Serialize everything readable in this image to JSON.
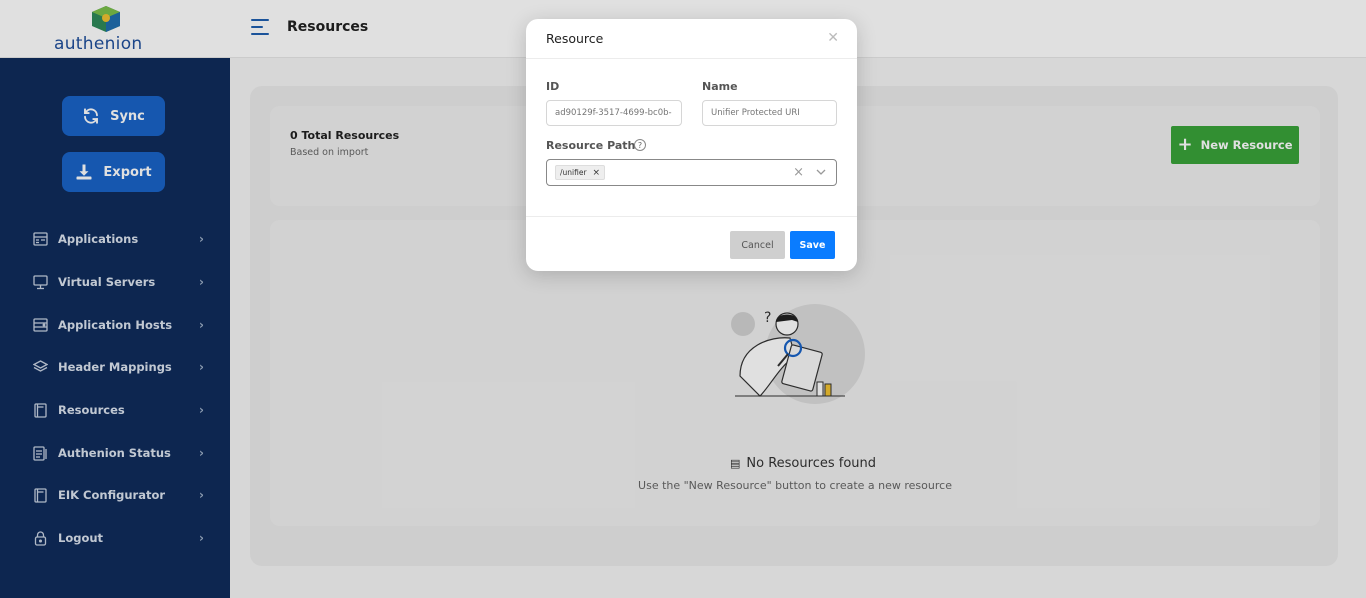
{
  "app": {
    "logo_text": "authenion",
    "page_title": "Resources"
  },
  "sidebar": {
    "sync_label": "Sync",
    "export_label": "Export",
    "items": [
      {
        "label": "Applications",
        "icon": "applications-icon"
      },
      {
        "label": "Virtual Servers",
        "icon": "monitor-icon"
      },
      {
        "label": "Application Hosts",
        "icon": "hosts-icon"
      },
      {
        "label": "Header Mappings",
        "icon": "layers-icon"
      },
      {
        "label": "Resources",
        "icon": "resources-icon"
      },
      {
        "label": "Authenion Status",
        "icon": "status-icon"
      },
      {
        "label": "EIK Configurator",
        "icon": "configurator-icon"
      },
      {
        "label": "Logout",
        "icon": "lock-icon"
      }
    ]
  },
  "summary": {
    "total_label": "0 Total Resources",
    "based_on": "Based on import",
    "new_button_label": "New Resource"
  },
  "empty_state": {
    "title": "No Resources found",
    "subtitle": "Use the \"New Resource\" button to create a new resource"
  },
  "modal": {
    "title": "Resource",
    "id_label": "ID",
    "id_placeholder": "ad90129f-3517-4699-bc0b-",
    "name_label": "Name",
    "name_placeholder": "Unifier Protected URI",
    "path_label": "Resource Path",
    "help_glyph": "?",
    "path_tags": [
      "/unifier"
    ],
    "cancel_label": "Cancel",
    "save_label": "Save"
  },
  "colors": {
    "sidebar_bg": "#0f2c5c",
    "sidebar_button": "#1a64c8",
    "new_button": "#3aa33a",
    "save_button": "#0a7cff",
    "cancel_button": "#cfcfcf",
    "brand_text": "#1f4f9c"
  }
}
